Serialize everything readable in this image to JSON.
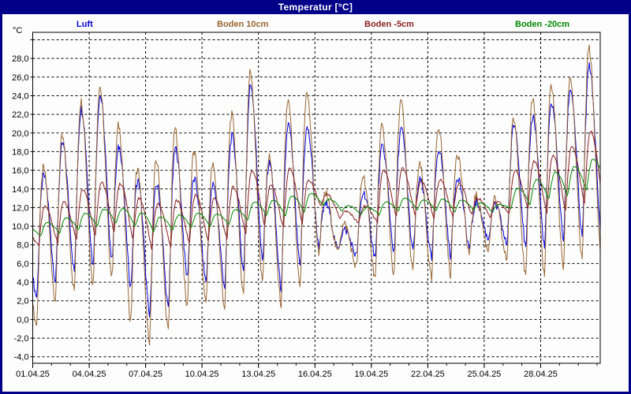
{
  "window": {
    "title": "Temperatur [°C]"
  },
  "colors": {
    "frame": "#000089",
    "titlebar_bg": "#000089",
    "titlebar_text": "#ffffff",
    "plot_bg": "#fdfdfd",
    "grid": "#000000",
    "axis_text": "#000000"
  },
  "legend": {
    "items": [
      {
        "label": "Luft",
        "color": "#0000dd"
      },
      {
        "label": "Boden 10cm",
        "color": "#996633"
      },
      {
        "label": "Boden -5cm",
        "color": "#8b2222"
      },
      {
        "label": "Boden -20cm",
        "color": "#008800"
      }
    ]
  },
  "chart_data": {
    "type": "line",
    "title": "Temperatur [°C]",
    "xlabel": "",
    "ylabel": "°C",
    "ylim": [
      -4.7,
      30.8
    ],
    "x_total_days": 30.17,
    "grid": "dashed",
    "legend_position": "top",
    "y_ticks": [
      {
        "v": 30,
        "label": ""
      },
      {
        "v": 28,
        "label": "28,0"
      },
      {
        "v": 26,
        "label": "26,0"
      },
      {
        "v": 24,
        "label": "24,0"
      },
      {
        "v": 22,
        "label": "22,0"
      },
      {
        "v": 20,
        "label": "20,0"
      },
      {
        "v": 18,
        "label": "18,0"
      },
      {
        "v": 16,
        "label": "16,0"
      },
      {
        "v": 14,
        "label": "14,0"
      },
      {
        "v": 12,
        "label": "12,0"
      },
      {
        "v": 10,
        "label": "10,0"
      },
      {
        "v": 8,
        "label": "8,0"
      },
      {
        "v": 6,
        "label": "6,0"
      },
      {
        "v": 4,
        "label": "4,0"
      },
      {
        "v": 2,
        "label": "2,0"
      },
      {
        "v": 0,
        "label": "0,0"
      },
      {
        "v": -2,
        "label": "-2,0"
      },
      {
        "v": -4,
        "label": "-4,0"
      }
    ],
    "x_ticks": [
      {
        "day": 0,
        "label": "01.04.25"
      },
      {
        "day": 3,
        "label": "04.04.25"
      },
      {
        "day": 6,
        "label": "07.04.25"
      },
      {
        "day": 9,
        "label": "10.04.25"
      },
      {
        "day": 12,
        "label": "13.04.25"
      },
      {
        "day": 15,
        "label": "16.04.25"
      },
      {
        "day": 18,
        "label": "19.04.25"
      },
      {
        "day": 21,
        "label": "22.04.25"
      },
      {
        "day": 24,
        "label": "25.04.25"
      },
      {
        "day": 27,
        "label": "28.04.25"
      }
    ],
    "x_minor_tick_every_days": 1,
    "series": [
      {
        "name": "Luft",
        "color": "#0000dd",
        "min_hour": 5.5,
        "peak_hour": 14,
        "fall_exp": 1.7,
        "jitter": 0.5,
        "prev_day_max": 9.0,
        "daily_max": [
          15.4,
          18.8,
          22.6,
          24.0,
          18.5,
          14.9,
          14.5,
          18.3,
          15.0,
          14.4,
          19.6,
          25.2,
          16.7,
          20.9,
          20.5,
          12.4,
          9.6,
          13.6,
          18.5,
          20.4,
          14.9,
          18.3,
          15.3,
          12.6,
          12.2,
          20.9,
          21.8,
          23.2,
          24.7,
          27.2,
          15.0
        ],
        "daily_min": [
          2.4,
          4.0,
          5.0,
          5.6,
          6.2,
          3.4,
          0.2,
          1.0,
          4.4,
          4.0,
          3.4,
          5.0,
          6.0,
          3.2,
          5.5,
          7.8,
          7.4,
          6.8,
          6.6,
          7.0,
          7.2,
          6.4,
          6.8,
          7.6,
          8.6,
          8.0,
          7.4,
          7.6,
          8.4,
          8.6,
          9.0
        ]
      },
      {
        "name": "Boden 10cm",
        "color": "#996633",
        "min_hour": 5.5,
        "peak_hour": 13.5,
        "fall_exp": 1.9,
        "jitter": 0.55,
        "prev_day_max": 7.5,
        "daily_max": [
          16.2,
          19.5,
          23.4,
          25.0,
          20.8,
          16.2,
          17.1,
          20.4,
          17.9,
          16.5,
          21.9,
          26.6,
          17.4,
          23.4,
          24.2,
          13.5,
          10.2,
          15.4,
          20.6,
          23.4,
          16.5,
          20.7,
          17.9,
          13.2,
          12.8,
          21.5,
          23.8,
          25.1,
          26.0,
          29.1,
          16.0
        ],
        "daily_min": [
          -0.6,
          2.0,
          3.0,
          3.6,
          4.4,
          -0.2,
          -2.8,
          -1.4,
          1.2,
          1.8,
          1.2,
          2.6,
          3.8,
          1.6,
          3.2,
          7.2,
          7.2,
          5.6,
          4.4,
          4.6,
          5.0,
          4.2,
          4.8,
          7.0,
          7.4,
          6.4,
          4.4,
          4.6,
          5.4,
          6.2,
          7.0
        ]
      },
      {
        "name": "Boden -5cm",
        "color": "#8b2222",
        "min_hour": 8,
        "peak_hour": 15.5,
        "fall_exp": 1.3,
        "jitter": 0.14,
        "prev_day_max": 9.2,
        "daily_max": [
          12.1,
          12.6,
          14.0,
          14.7,
          14.6,
          13.0,
          12.4,
          12.8,
          13.3,
          13.0,
          14.2,
          16.0,
          14.4,
          16.2,
          14.9,
          13.4,
          11.6,
          12.2,
          16.0,
          16.2,
          14.8,
          15.0,
          14.6,
          13.0,
          12.6,
          16.0,
          17.0,
          17.6,
          18.6,
          20.2,
          16.0
        ],
        "daily_min": [
          8.0,
          8.2,
          8.6,
          9.0,
          9.4,
          8.6,
          7.6,
          7.8,
          8.2,
          8.4,
          8.6,
          9.2,
          10.0,
          9.8,
          10.2,
          12.2,
          10.9,
          10.3,
          10.4,
          11.0,
          11.2,
          10.8,
          11.0,
          11.2,
          11.0,
          11.4,
          11.8,
          11.4,
          11.6,
          12.4,
          12.4
        ]
      },
      {
        "name": "Boden -20cm",
        "color": "#008800",
        "min_hour": 10.5,
        "peak_hour": 18.5,
        "fall_exp": 1.0,
        "jitter": 0.06,
        "prev_day_max": 9.8,
        "daily_max": [
          10.4,
          10.9,
          11.4,
          11.8,
          11.9,
          11.4,
          11.0,
          11.2,
          11.4,
          11.3,
          11.8,
          12.6,
          12.8,
          13.2,
          13.5,
          12.9,
          12.2,
          12.0,
          12.6,
          13.0,
          12.8,
          12.9,
          12.8,
          12.5,
          12.3,
          14.1,
          15.0,
          15.8,
          16.4,
          17.2,
          16.5
        ],
        "daily_min": [
          8.9,
          9.2,
          9.6,
          10.0,
          10.3,
          9.9,
          9.3,
          9.5,
          9.8,
          9.9,
          10.1,
          10.6,
          11.1,
          11.0,
          11.4,
          12.2,
          11.6,
          11.2,
          11.2,
          11.6,
          11.7,
          11.6,
          11.5,
          11.7,
          11.5,
          11.9,
          12.2,
          12.8,
          13.2,
          13.8,
          14.5
        ]
      }
    ]
  }
}
